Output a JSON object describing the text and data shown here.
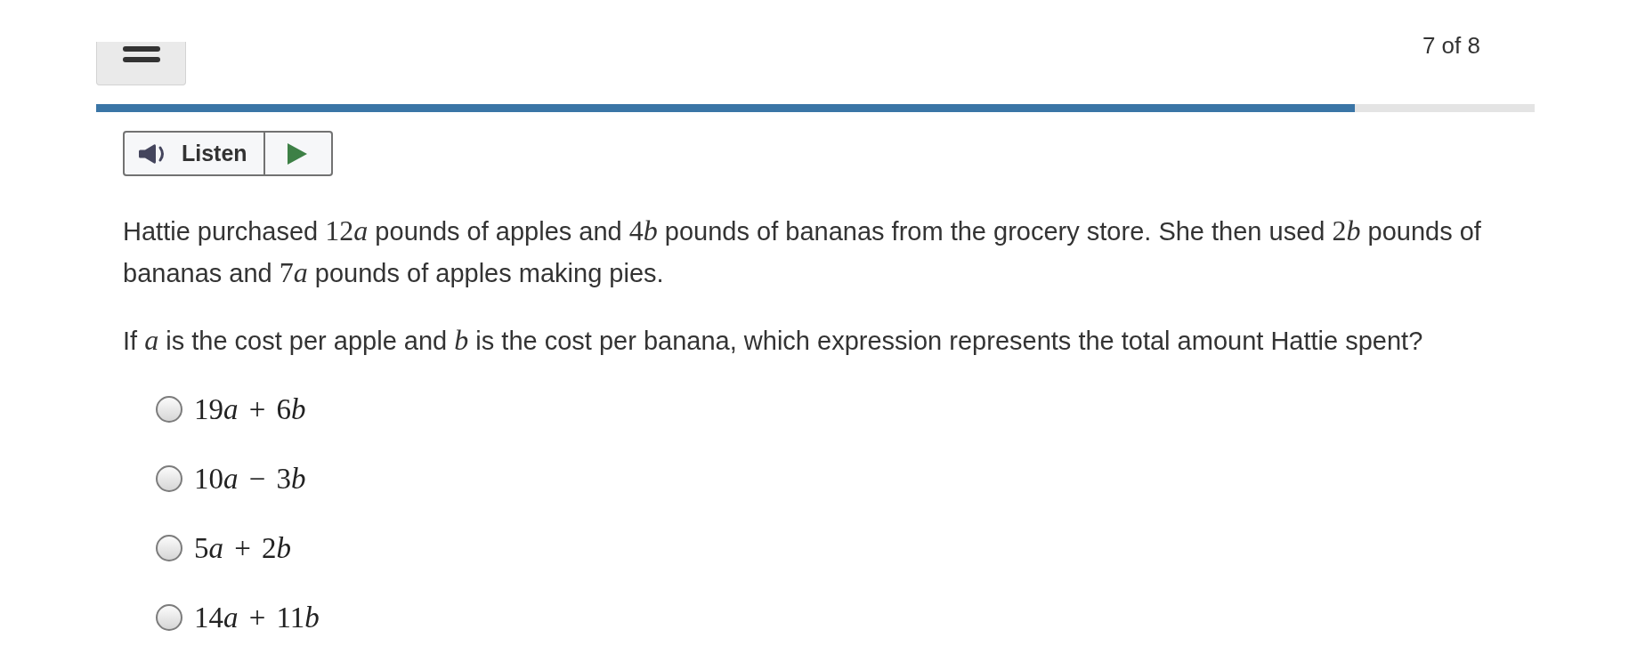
{
  "header": {
    "page_counter": "7 of 8"
  },
  "progress": {
    "level": 0.875
  },
  "audio": {
    "listen_label": "Listen"
  },
  "question": {
    "paragraphs": [
      [
        {
          "kind": "text",
          "text": "Hattie purchased "
        },
        {
          "kind": "math",
          "text": "12a"
        },
        {
          "kind": "text",
          "text": " pounds of apples and "
        },
        {
          "kind": "math",
          "text": "4b"
        },
        {
          "kind": "text",
          "text": " pounds of bananas from the grocery store. She then used "
        },
        {
          "kind": "math",
          "text": "2b"
        },
        {
          "kind": "text",
          "text": " pounds of bananas and "
        },
        {
          "kind": "math",
          "text": "7a"
        },
        {
          "kind": "text",
          "text": " pounds of apples making pies."
        }
      ],
      [
        {
          "kind": "text",
          "text": "If "
        },
        {
          "kind": "math",
          "text": "a"
        },
        {
          "kind": "text",
          "text": " is the cost per apple and "
        },
        {
          "kind": "math",
          "text": "b"
        },
        {
          "kind": "text",
          "text": " is the cost per banana, which expression represents the total amount Hattie spent?"
        }
      ]
    ]
  },
  "options": [
    {
      "expression": "19a + 6b",
      "selected": false
    },
    {
      "expression": "10a − 3b",
      "selected": false
    },
    {
      "expression": "5a + 2b",
      "selected": false
    },
    {
      "expression": "14a + 11b",
      "selected": false
    }
  ]
}
